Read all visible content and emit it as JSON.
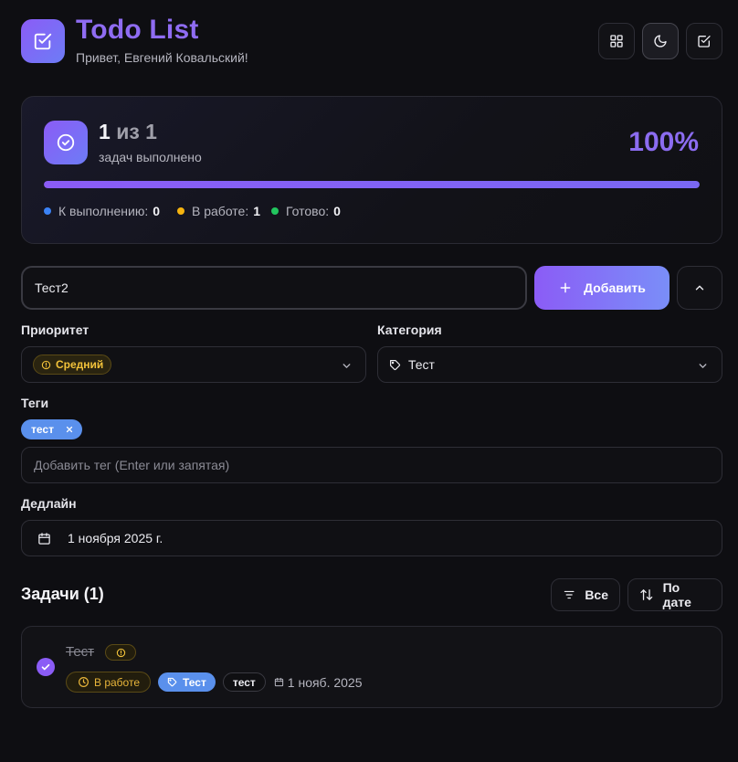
{
  "header": {
    "title": "Todo List",
    "greeting": "Привет, Евгений Ковальский!"
  },
  "stats": {
    "completed": "1",
    "of_total": "из 1",
    "subtitle": "задач выполнено",
    "percent_text": "100%",
    "progress": 1.0,
    "legend": [
      {
        "label": "К выполнению:",
        "value": "0",
        "color": "#3b82f6"
      },
      {
        "label": "В работе:",
        "value": "1",
        "color": "#f5b30f"
      },
      {
        "label": "Готово:",
        "value": "0",
        "color": "#22c55e"
      }
    ]
  },
  "form": {
    "task_value": "Тест2",
    "add_label": "Добавить",
    "priority_label": "Приоритет",
    "priority_value": "Средний",
    "category_label": "Категория",
    "category_value": "Тест",
    "tags_label": "Теги",
    "tags": [
      "тест"
    ],
    "tag_placeholder": "Добавить тег (Enter или запятая)",
    "deadline_label": "Дедлайн",
    "deadline_value": "1 ноября 2025 г."
  },
  "tasks": {
    "heading": "Задачи (1)",
    "filter_label": "Все",
    "sort_label": "По дате",
    "items": [
      {
        "title": "Тест",
        "status": "В работе",
        "category": "Тест",
        "tag": "тест",
        "date": "1 нояб. 2025",
        "done": true
      }
    ]
  },
  "colors": {
    "accent": "#8b5cf6",
    "accent_text": "#8f6cf2",
    "category_blue": "#5a90ec",
    "warning": "#f2c23a"
  },
  "icons": [
    "checkbox-icon",
    "grid-icon",
    "moon-icon",
    "check-square-icon",
    "check-circle-icon",
    "plus-icon",
    "chevron-up-icon",
    "info-icon",
    "chevron-down-icon",
    "tag-icon",
    "close-icon",
    "calendar-icon",
    "filter-icon",
    "sort-icon",
    "clock-icon"
  ]
}
